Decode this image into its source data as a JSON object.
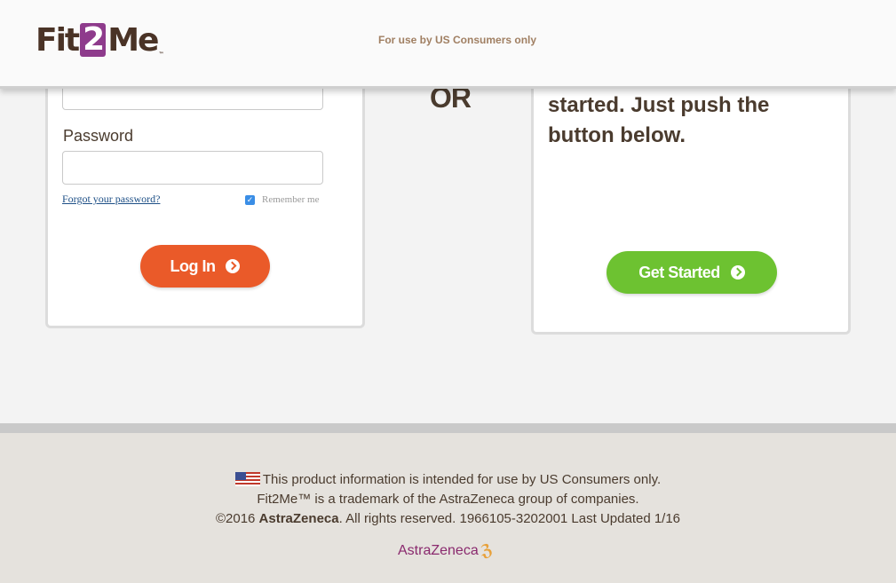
{
  "header": {
    "logo": {
      "fit": "Fit",
      "two": "2",
      "me": "Me",
      "tm": "™"
    },
    "notice": "For use by US Consumers only"
  },
  "login": {
    "password_label": "Password",
    "password_value": "",
    "forgot_link": "Forgot your password?",
    "remember_label": "Remember me",
    "remember_checked": true,
    "login_button": "Log In"
  },
  "divider": {
    "or_text": "OR"
  },
  "start": {
    "text": "started. Just push the button below.",
    "button": "Get Started"
  },
  "footer": {
    "line1": "This product information is intended for use by US Consumers only.",
    "line2": "Fit2Me™ is a trademark of the AstraZeneca group of companies.",
    "line3_prefix": "©2016 ",
    "line3_brand": "AstraZeneca",
    "line3_suffix": ". All rights reserved. 1966105-3202001 Last Updated 1/16",
    "logo_text": "AstraZeneca"
  },
  "colors": {
    "login_button": "#ea5a29",
    "start_button": "#6dc231",
    "brand_purple": "#8e3b8c",
    "link": "#1d4f86"
  }
}
